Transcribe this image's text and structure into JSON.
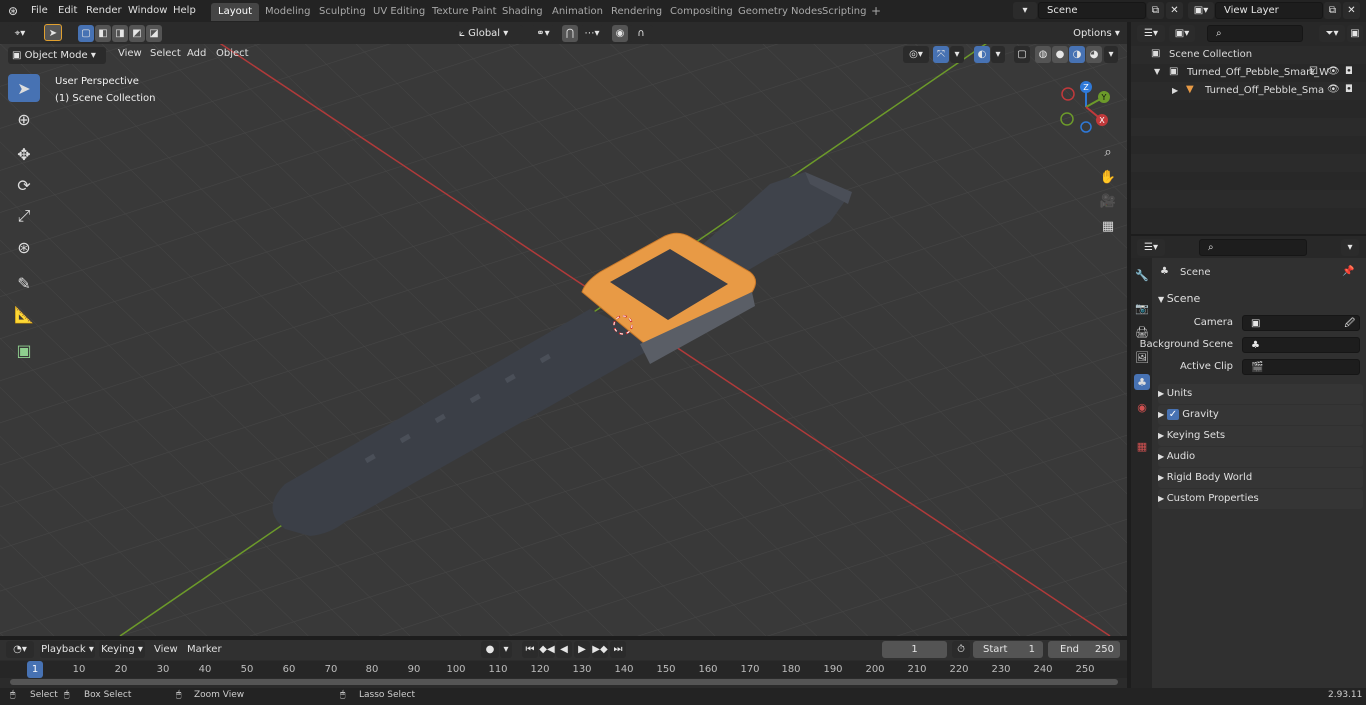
{
  "topbar": {
    "menus": [
      "File",
      "Edit",
      "Render",
      "Window",
      "Help"
    ],
    "workspaces": [
      "Layout",
      "Modeling",
      "Sculpting",
      "UV Editing",
      "Texture Paint",
      "Shading",
      "Animation",
      "Rendering",
      "Compositing",
      "Geometry Nodes",
      "Scripting"
    ],
    "active_workspace": "Layout",
    "scene_name": "Scene",
    "view_layer": "View Layer",
    "add_tab_symbol": "+"
  },
  "tool_header": {
    "transform_orientation": "Global",
    "options_label": "Options"
  },
  "viewport_header": {
    "mode": "Object Mode",
    "menus": [
      "View",
      "Select",
      "Add",
      "Object"
    ]
  },
  "viewport": {
    "overlay_line1": "User Perspective",
    "overlay_line2": "(1) Scene Collection",
    "gizmo_axes": [
      "Z",
      "Y",
      "X"
    ]
  },
  "outliner": {
    "search_placeholder": "",
    "root": "Scene Collection",
    "items": [
      {
        "label": "Turned_Off_Pebble_Smart_W",
        "level": 1
      },
      {
        "label": "Turned_Off_Pebble_Sma",
        "level": 2
      }
    ]
  },
  "properties": {
    "header_title": "Scene",
    "section_scene": "Scene",
    "fields": [
      {
        "label": "Camera",
        "value": ""
      },
      {
        "label": "Background Scene",
        "value": ""
      },
      {
        "label": "Active Clip",
        "value": ""
      }
    ],
    "panels": [
      "Units",
      "Gravity",
      "Keying Sets",
      "Audio",
      "Rigid Body World",
      "Custom Properties"
    ],
    "gravity_enabled": true
  },
  "timeline": {
    "menus": [
      "Playback",
      "Keying",
      "View",
      "Marker"
    ],
    "current_frame": "1",
    "start_label": "Start",
    "start_value": "1",
    "end_label": "End",
    "end_value": "250",
    "ruler_marks": [
      "1",
      "10",
      "20",
      "30",
      "40",
      "50",
      "60",
      "70",
      "80",
      "90",
      "100",
      "110",
      "120",
      "130",
      "140",
      "150",
      "160",
      "170",
      "180",
      "190",
      "200",
      "210",
      "220",
      "230",
      "240",
      "250"
    ]
  },
  "statusbar": {
    "select": "Select",
    "box_select": "Box Select",
    "zoom_view": "Zoom View",
    "lasso_select": "Lasso Select",
    "version": "2.93.11"
  },
  "colors": {
    "accent": "#4772b3",
    "x_axis": "#c0393b",
    "y_axis": "#6c9a2a",
    "z_axis": "#2f79d8",
    "watch_frame": "#e89a45",
    "strap": "#3b3f47"
  }
}
